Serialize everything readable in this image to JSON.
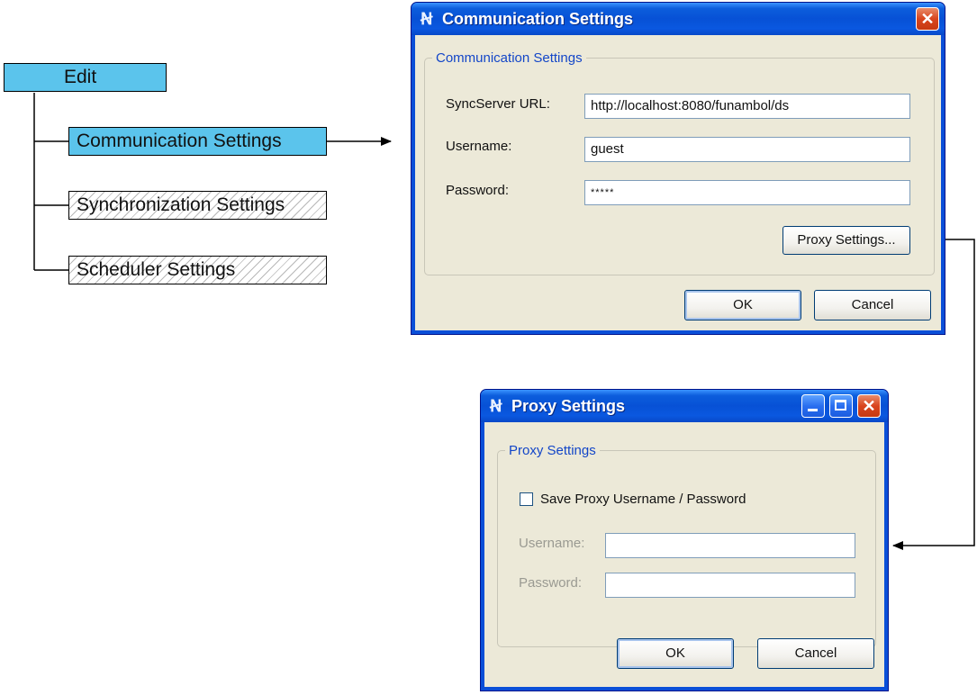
{
  "tree": {
    "root": "Edit",
    "items": [
      "Communication Settings",
      "Synchronization Settings",
      "Scheduler Settings"
    ]
  },
  "comm_dialog": {
    "title": "Communication Settings",
    "close_glyph": "✕",
    "group_label": "Communication Settings",
    "url_label": "SyncServer URL:",
    "url_value": "http://localhost:8080/funambol/ds",
    "username_label": "Username:",
    "username_value": "guest",
    "password_label": "Password:",
    "password_value": "*****",
    "proxy_button": "Proxy Settings...",
    "ok_button": "OK",
    "cancel_button": "Cancel"
  },
  "proxy_dialog": {
    "title": "Proxy Settings",
    "group_label": "Proxy Settings",
    "save_checkbox_label": "Save Proxy Username / Password",
    "save_checked": false,
    "username_label": "Username:",
    "username_value": "",
    "password_label": "Password:",
    "password_value": "",
    "ok_button": "OK",
    "cancel_button": "Cancel",
    "close_glyph": "✕"
  },
  "colors": {
    "active_box": "#5bc4ec",
    "xp_title": "#0a4fd8",
    "group_legend": "#1346c8"
  },
  "icons": [
    "app-logo-icon",
    "close-icon",
    "minimize-icon",
    "maximize-icon",
    "arrow-right-icon",
    "arrow-left-icon"
  ]
}
